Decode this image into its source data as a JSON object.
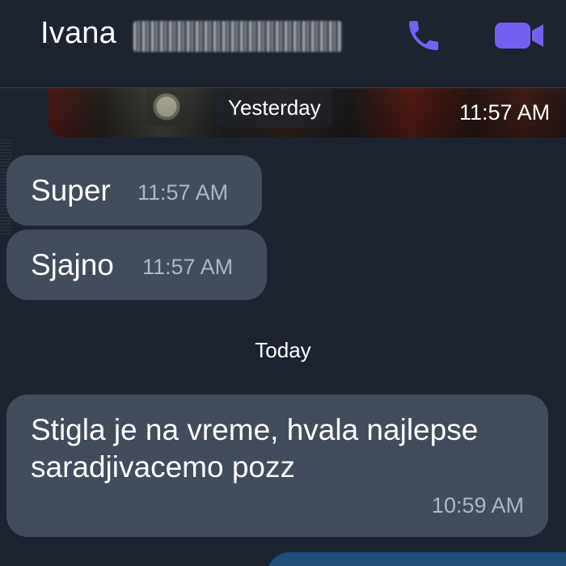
{
  "header": {
    "contact_name": "Ivana",
    "call_icon": "phone-icon",
    "video_icon": "video-camera-icon"
  },
  "colors": {
    "background": "#1d2430",
    "bubble": "#434c5a",
    "accent": "#7360f2",
    "timestamp": "#aeb6c2",
    "outgoing_bubble": "#1f4d7a"
  },
  "media_strip": {
    "date_label": "Yesterday",
    "time": "11:57 AM"
  },
  "messages": [
    {
      "text": "Super",
      "time": "11:57 AM"
    },
    {
      "text": "Sjajno",
      "time": "11:57 AM"
    },
    {
      "text": "Stigla je na vreme, hvala najlepse\nsaradjivacemo pozz",
      "time": "10:59 AM"
    }
  ],
  "separators": {
    "today": "Today"
  }
}
